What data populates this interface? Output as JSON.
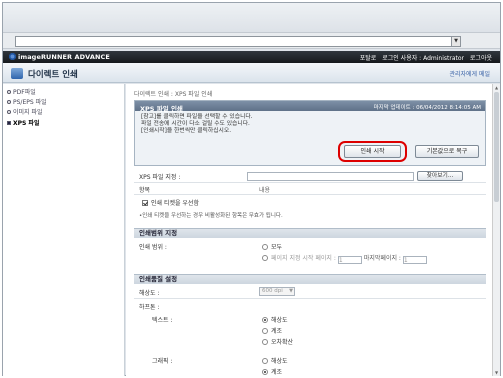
{
  "browser": {
    "url_value": "",
    "dropdown_icon": "chevron-down-icon"
  },
  "header": {
    "brand": "imageRUNNER ADVANCE",
    "portal_link": "포탈로",
    "login_user_label": "로그인 사용자 : Administrator",
    "logout_link": "로그아웃"
  },
  "title_bar": {
    "title": "다이렉트 인쇄",
    "admin_link": "관리자에게 메일"
  },
  "sidebar": {
    "items": [
      {
        "label": "PDF파일"
      },
      {
        "label": "PS/EPS 파일"
      },
      {
        "label": "이미지 파일"
      },
      {
        "label": "XPS 파일"
      }
    ]
  },
  "main": {
    "breadcrumb": "다이렉트 인쇄 : XPS 파일 인쇄",
    "panel": {
      "title": "XPS 파일 인쇄",
      "last_update": "마지막 업데이트 : 06/04/2012 8:14:05 AM",
      "notice_1": "[참고]를 클릭하면 파일을 선택할 수 있습니다.",
      "notice_2": "파일 전송에 시간이 다소 걸릴 수도 있습니다.",
      "notice_3": "[인쇄시작]을 한번씩만 클릭하십시오.",
      "print_button": "인쇄 시작",
      "reset_button": "기본값으로 복구"
    },
    "file": {
      "label": "XPS 파일 지정 :",
      "value": "",
      "browse_button": "찾아보기..."
    },
    "items_header": {
      "label": "항목",
      "value": "내용"
    },
    "ticket": {
      "checkbox_label": "인쇄 티켓을 우선함",
      "checked": true,
      "note": "•인쇄 티켓을 우선하는 경우 비활성화된 항목은 무효가 됩니다."
    },
    "range": {
      "section_title": "인쇄범위 지정",
      "label": "인쇄 범위 :",
      "option_all": "모두",
      "option_pages": "페이지 지정 시작 페이지 :",
      "start_value": "1",
      "end_label": "마지막페이지 :",
      "end_value": "1",
      "selected": "모두"
    },
    "quality": {
      "section_title": "인쇄품질 설정",
      "resolution_label": "해상도 :",
      "resolution_value": "600 dpi",
      "halftone_label": "하프톤 :",
      "text_label": "텍스트 :",
      "text_options": [
        "해상도",
        "계조",
        "오차확산"
      ],
      "text_selected": "해상도",
      "graphic_label": "그래픽 :",
      "graphic_options": [
        "해상도",
        "계조"
      ],
      "graphic_selected": "계조"
    }
  }
}
